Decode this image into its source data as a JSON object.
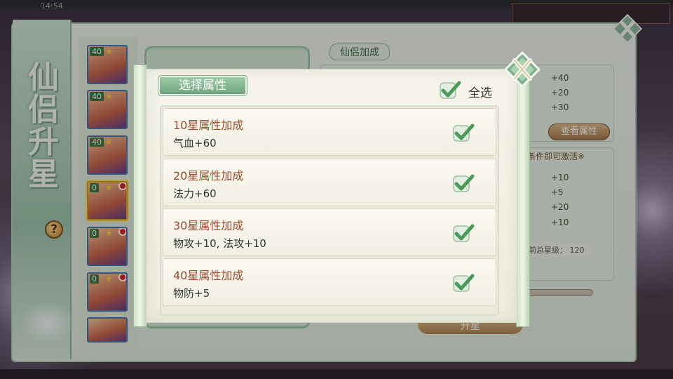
{
  "background": {
    "clock": "14:54",
    "page_title": "仙侣升星",
    "help_label": "?",
    "portraits": [
      {
        "level": "40",
        "red_dot": false,
        "selected": false
      },
      {
        "level": "40",
        "red_dot": false,
        "selected": false
      },
      {
        "level": "40",
        "red_dot": false,
        "selected": false
      },
      {
        "level": "0",
        "red_dot": true,
        "selected": true
      },
      {
        "level": "0",
        "red_dot": true,
        "selected": false
      },
      {
        "level": "0",
        "red_dot": true,
        "selected": false
      }
    ],
    "right_panel": {
      "tag": "仙侣加成",
      "bonus_values": [
        "+40",
        "+20",
        "+30"
      ],
      "view_attr_label": "查看属性",
      "activate_note": "数条件即可激活※",
      "activate_values": [
        "+10",
        "+5",
        "+20",
        "+10"
      ],
      "total_star_label": "前总星级：",
      "total_star_value": "120",
      "upgrade_label": "升星"
    }
  },
  "modal": {
    "title": "选择属性",
    "select_all_label": "全选",
    "select_all_checked": true,
    "items": [
      {
        "title": "10星属性加成",
        "desc": "气血+60",
        "checked": true
      },
      {
        "title": "20星属性加成",
        "desc": "法力+60",
        "checked": true
      },
      {
        "title": "30星属性加成",
        "desc": "物攻+10, 法攻+10",
        "checked": true
      },
      {
        "title": "40星属性加成",
        "desc": "物防+5",
        "checked": true
      }
    ]
  },
  "colors": {
    "accent_green": "#6fa47e",
    "check_green": "#4a9a5a",
    "title_brown": "#9a4b2a",
    "parchment": "#f7f4ea"
  }
}
